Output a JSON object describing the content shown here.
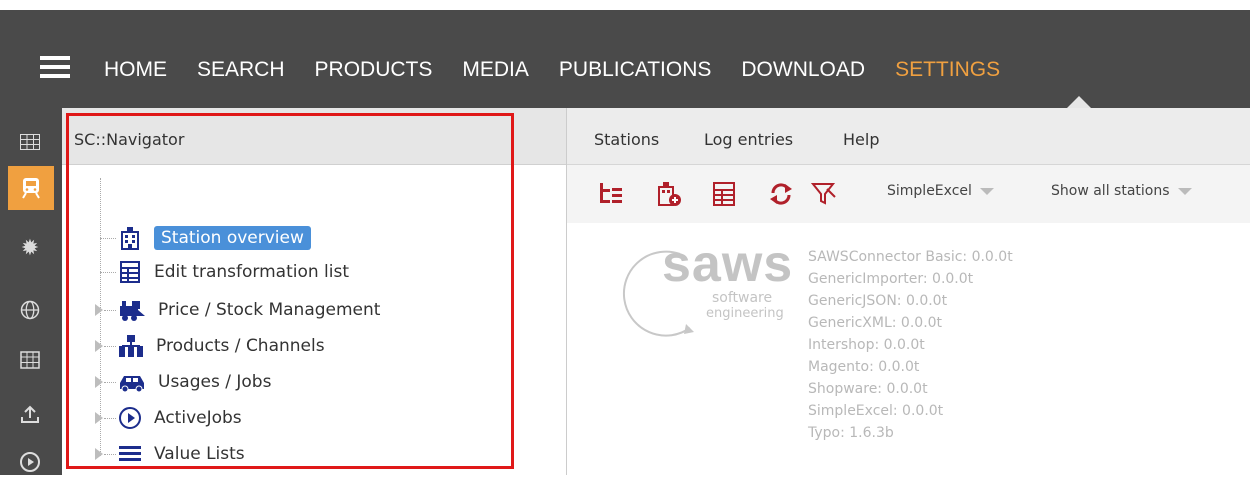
{
  "topnav": {
    "menu_icon": "hamburger-menu-icon",
    "items": [
      {
        "label": "HOME"
      },
      {
        "label": "SEARCH"
      },
      {
        "label": "PRODUCTS"
      },
      {
        "label": "MEDIA"
      },
      {
        "label": "PUBLICATIONS"
      },
      {
        "label": "DOWNLOAD"
      },
      {
        "label": "SETTINGS",
        "active": true
      }
    ],
    "active_color": "#f0a040"
  },
  "sidebar": {
    "icons": [
      "grid-icon",
      "train-icon",
      "gear-icon",
      "globe-icon",
      "table-icon",
      "upload-icon",
      "play-icon"
    ],
    "active_index": 1
  },
  "navigator": {
    "title": "SC::Navigator",
    "tree": [
      {
        "label": "Station overview",
        "icon": "building-icon",
        "selected": true,
        "expandable": false
      },
      {
        "label": "Edit transformation list",
        "icon": "list-icon",
        "expandable": false
      },
      {
        "label": "Price / Stock Management",
        "icon": "train-icon",
        "expandable": true
      },
      {
        "label": "Products / Channels",
        "icon": "hierarchy-icon",
        "expandable": true
      },
      {
        "label": "Usages / Jobs",
        "icon": "car-icon",
        "expandable": true
      },
      {
        "label": "ActiveJobs",
        "icon": "play-circle-icon",
        "expandable": true
      },
      {
        "label": "Value Lists",
        "icon": "lines-icon",
        "expandable": true
      }
    ]
  },
  "stations": {
    "menu": [
      "Stations",
      "Log entries",
      "Help"
    ],
    "toolbar_icons": [
      "tree-add-icon",
      "building-add-icon",
      "list-icon",
      "refresh-icon",
      "filter-icon"
    ],
    "combo_station": "SimpleExcel",
    "combo_filter": "Show all stations",
    "logo_text": "saws",
    "logo_sub1": "software",
    "logo_sub2": "engineering",
    "versions": [
      "SAWSConnector Basic: 0.0.0t",
      "GenericImporter: 0.0.0t",
      "GenericJSON: 0.0.0t",
      "GenericXML: 0.0.0t",
      "Intershop: 0.0.0t",
      "Magento: 0.0.0t",
      "Shopware: 0.0.0t",
      "SimpleExcel: 0.0.0t",
      "Typo: 1.6.3b"
    ]
  },
  "colors": {
    "topbar": "#4a4a4a",
    "highlight": "#e01818",
    "selected": "#4a90d9",
    "icon_red": "#b0202a",
    "icon_blue": "#1c2d8c"
  }
}
